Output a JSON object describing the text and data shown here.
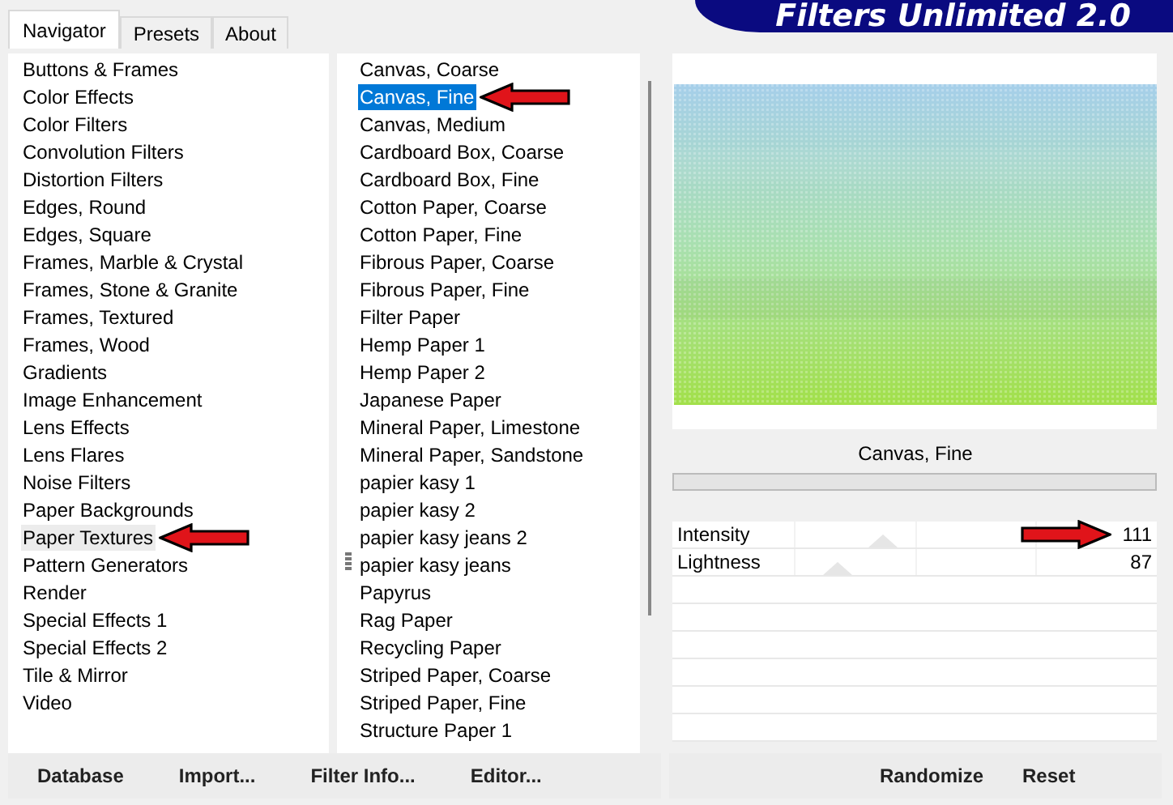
{
  "banner": {
    "title": "Filters Unlimited 2.0"
  },
  "tabs": [
    {
      "label": "Navigator",
      "selected": true
    },
    {
      "label": "Presets",
      "selected": false
    },
    {
      "label": "About",
      "selected": false
    }
  ],
  "categories": [
    {
      "label": "Buttons & Frames",
      "selected": false,
      "marked": false
    },
    {
      "label": "Color Effects",
      "selected": false,
      "marked": false
    },
    {
      "label": "Color Filters",
      "selected": false,
      "marked": false
    },
    {
      "label": "Convolution Filters",
      "selected": false,
      "marked": false
    },
    {
      "label": "Distortion Filters",
      "selected": false,
      "marked": false
    },
    {
      "label": "Edges, Round",
      "selected": false,
      "marked": false
    },
    {
      "label": "Edges, Square",
      "selected": false,
      "marked": false
    },
    {
      "label": "Frames, Marble & Crystal",
      "selected": false,
      "marked": false
    },
    {
      "label": "Frames, Stone & Granite",
      "selected": false,
      "marked": false
    },
    {
      "label": "Frames, Textured",
      "selected": false,
      "marked": false
    },
    {
      "label": "Frames, Wood",
      "selected": false,
      "marked": false
    },
    {
      "label": "Gradients",
      "selected": false,
      "marked": false
    },
    {
      "label": "Image Enhancement",
      "selected": false,
      "marked": false
    },
    {
      "label": "Lens Effects",
      "selected": false,
      "marked": false
    },
    {
      "label": "Lens Flares",
      "selected": false,
      "marked": false
    },
    {
      "label": "Noise Filters",
      "selected": false,
      "marked": false
    },
    {
      "label": "Paper Backgrounds",
      "selected": false,
      "marked": false
    },
    {
      "label": "Paper Textures",
      "selected": true,
      "marked": true
    },
    {
      "label": "Pattern Generators",
      "selected": false,
      "marked": false
    },
    {
      "label": "Render",
      "selected": false,
      "marked": false
    },
    {
      "label": "Special Effects 1",
      "selected": false,
      "marked": false
    },
    {
      "label": "Special Effects 2",
      "selected": false,
      "marked": false
    },
    {
      "label": "Tile & Mirror",
      "selected": false,
      "marked": false
    },
    {
      "label": "Video",
      "selected": false,
      "marked": false
    }
  ],
  "filters": [
    {
      "label": "Canvas, Coarse",
      "selected": false,
      "marked": false
    },
    {
      "label": "Canvas, Fine",
      "selected": true,
      "marked": true
    },
    {
      "label": "Canvas, Medium",
      "selected": false,
      "marked": false
    },
    {
      "label": "Cardboard Box, Coarse",
      "selected": false,
      "marked": false
    },
    {
      "label": "Cardboard Box, Fine",
      "selected": false,
      "marked": false
    },
    {
      "label": "Cotton Paper, Coarse",
      "selected": false,
      "marked": false
    },
    {
      "label": "Cotton Paper, Fine",
      "selected": false,
      "marked": false
    },
    {
      "label": "Fibrous Paper, Coarse",
      "selected": false,
      "marked": false
    },
    {
      "label": "Fibrous Paper, Fine",
      "selected": false,
      "marked": false
    },
    {
      "label": "Filter Paper",
      "selected": false,
      "marked": false
    },
    {
      "label": "Hemp Paper 1",
      "selected": false,
      "marked": false
    },
    {
      "label": "Hemp Paper 2",
      "selected": false,
      "marked": false
    },
    {
      "label": "Japanese Paper",
      "selected": false,
      "marked": false
    },
    {
      "label": "Mineral Paper, Limestone",
      "selected": false,
      "marked": false
    },
    {
      "label": "Mineral Paper, Sandstone",
      "selected": false,
      "marked": false
    },
    {
      "label": "papier kasy 1",
      "selected": false,
      "marked": false
    },
    {
      "label": "papier kasy 2",
      "selected": false,
      "marked": false
    },
    {
      "label": "papier kasy jeans 2",
      "selected": false,
      "marked": false
    },
    {
      "label": "papier kasy jeans",
      "selected": false,
      "marked": false
    },
    {
      "label": "Papyrus",
      "selected": false,
      "marked": false
    },
    {
      "label": "Rag Paper",
      "selected": false,
      "marked": false
    },
    {
      "label": "Recycling Paper",
      "selected": false,
      "marked": false
    },
    {
      "label": "Striped Paper, Coarse",
      "selected": false,
      "marked": false
    },
    {
      "label": "Striped Paper, Fine",
      "selected": false,
      "marked": false
    },
    {
      "label": "Structure Paper 1",
      "selected": false,
      "marked": false
    }
  ],
  "preview": {
    "kind": "picture",
    "caption": "Canvas, Fine"
  },
  "parameters": [
    {
      "name": "Intensity",
      "value": "111",
      "level": 0.435,
      "marked": true
    },
    {
      "name": "Lightness",
      "value": "87",
      "level": 0.341,
      "marked": false
    }
  ],
  "left_buttons": [
    "Database",
    "Import...",
    "Filter Info...",
    "Editor..."
  ],
  "right_buttons": [
    "Randomize",
    "Reset"
  ]
}
